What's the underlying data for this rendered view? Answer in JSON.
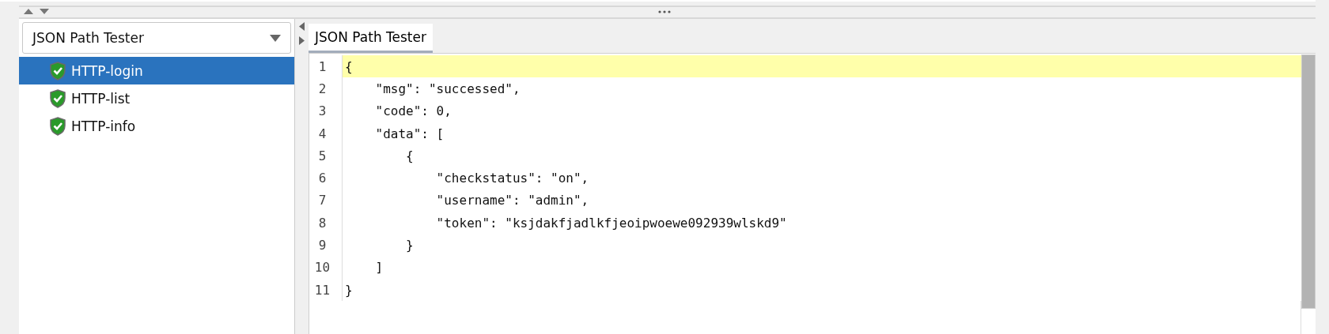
{
  "dropdown": {
    "value": "JSON Path Tester"
  },
  "tree": {
    "items": [
      {
        "label": "HTTP-login",
        "selected": true
      },
      {
        "label": "HTTP-list",
        "selected": false
      },
      {
        "label": "HTTP-info",
        "selected": false
      }
    ]
  },
  "tabs": [
    {
      "label": "JSON Path Tester",
      "selected": true
    }
  ],
  "editor": {
    "lines": [
      {
        "number": "1",
        "text": "{",
        "highlighted": true
      },
      {
        "number": "2",
        "text": "    \"msg\": \"successed\",",
        "highlighted": false
      },
      {
        "number": "3",
        "text": "    \"code\": 0,",
        "highlighted": false
      },
      {
        "number": "4",
        "text": "    \"data\": [",
        "highlighted": false
      },
      {
        "number": "5",
        "text": "        {",
        "highlighted": false
      },
      {
        "number": "6",
        "text": "            \"checkstatus\": \"on\",",
        "highlighted": false
      },
      {
        "number": "7",
        "text": "            \"username\": \"admin\",",
        "highlighted": false
      },
      {
        "number": "8",
        "text": "            \"token\": \"ksjdakfjadlkfjeoipwoewe092939wlskd9\"",
        "highlighted": false
      },
      {
        "number": "9",
        "text": "        }",
        "highlighted": false
      },
      {
        "number": "10",
        "text": "    ]",
        "highlighted": false
      },
      {
        "number": "11",
        "text": "}",
        "highlighted": false
      }
    ]
  }
}
